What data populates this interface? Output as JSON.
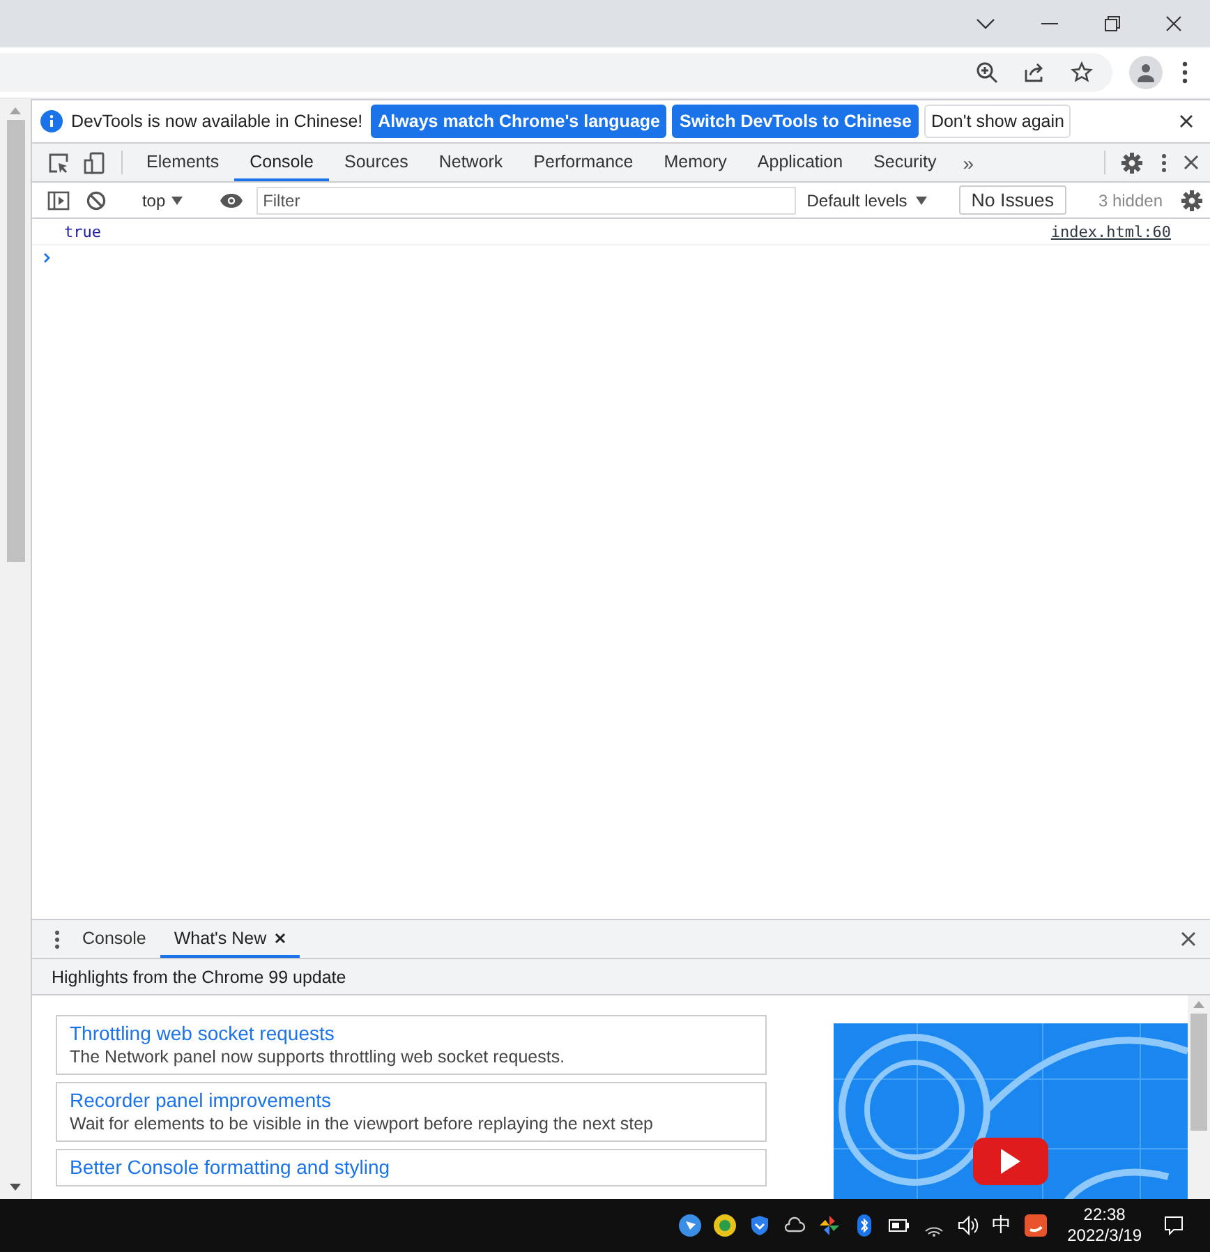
{
  "infobar": {
    "message": "DevTools is now available in Chinese!",
    "buttons": [
      {
        "label": "Always match Chrome's language",
        "kind": "primary"
      },
      {
        "label": "Switch DevTools to Chinese",
        "kind": "primary"
      },
      {
        "label": "Don't show again",
        "kind": "secondary"
      }
    ]
  },
  "main_tabs": [
    {
      "label": "Elements",
      "selected": false
    },
    {
      "label": "Console",
      "selected": true
    },
    {
      "label": "Sources",
      "selected": false
    },
    {
      "label": "Network",
      "selected": false
    },
    {
      "label": "Performance",
      "selected": false
    },
    {
      "label": "Memory",
      "selected": false
    },
    {
      "label": "Application",
      "selected": false
    },
    {
      "label": "Security",
      "selected": false
    }
  ],
  "more_tabs": "»",
  "console_toolbar": {
    "context": "top",
    "filter_placeholder": "Filter",
    "levels": "Default levels",
    "issues": "No Issues",
    "hidden": "3 hidden"
  },
  "messages": [
    {
      "text": "true",
      "source": "index.html:60"
    }
  ],
  "drawer": {
    "tabs": [
      {
        "label": "Console",
        "selected": false,
        "closable": false
      },
      {
        "label": "What's New",
        "selected": true,
        "closable": true
      }
    ],
    "header": "Highlights from the Chrome 99 update",
    "items": [
      {
        "title": "Throttling web socket requests",
        "description": "The Network panel now supports throttling web socket requests."
      },
      {
        "title": "Recorder panel improvements",
        "description": "Wait for elements to be visible in the viewport before replaying the next step"
      },
      {
        "title": "Better Console formatting and styling"
      }
    ]
  },
  "taskbar": {
    "ime": "中",
    "time": "22:38",
    "date": "2022/3/19"
  }
}
